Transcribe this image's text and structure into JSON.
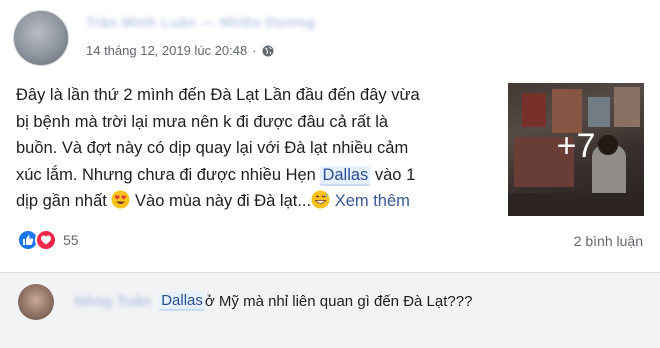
{
  "post": {
    "author_name": "Trần Minh Luân — Nhiều Dương",
    "timestamp": "14 tháng 12, 2019 lúc 20:48",
    "separator": "·",
    "privacy_icon": "globe-icon",
    "text_lines": [
      "Đây là lần thứ 2 mình đến Đà Lạt Lần đầu đến đây vừa",
      "bị bệnh mà trời lại mưa nên k đi được đâu cả rất là",
      "buồn. Và đợt này có dịp quay lại với Đà lạt nhiều cảm"
    ],
    "line4_before": "xúc lắm. Nhưng chưa đi được nhiều Hẹn ",
    "line4_mention": "Dallas",
    "line4_after": " vào 1",
    "line5_before": "dịp gần nhất ",
    "line5_emoji1": "heart-eyes-emoji",
    "line5_middle": " Vào mùa này đi Đà lạt...",
    "line5_emoji2": "grinning-sweat-emoji",
    "see_more": "Xem thêm",
    "photo_more_count": "+7"
  },
  "reactions": {
    "icons": [
      "like-icon",
      "love-icon"
    ],
    "count": "55",
    "comments_count": "2 bình luận"
  },
  "comment": {
    "author_name": "Nông Tuấn",
    "mention": "Dallas",
    "text": " ở Mỹ mà nhỉ liên quan gì đến Đà Lạt???"
  },
  "colors": {
    "link": "#385898",
    "like_blue": "#1877f2",
    "love_red": "#f02849",
    "meta_gray": "#616770",
    "comment_bg": "#f2f3f5"
  }
}
